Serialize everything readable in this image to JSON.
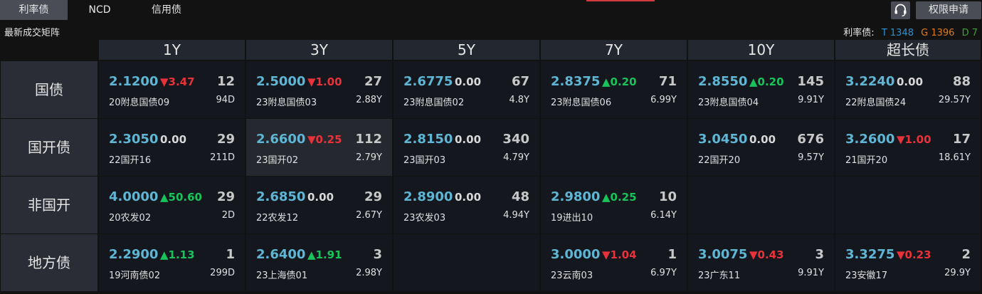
{
  "tabs": [
    {
      "label": "利率债",
      "active": true
    },
    {
      "label": "NCD",
      "active": false
    },
    {
      "label": "信用债",
      "active": false
    }
  ],
  "header_icon": "headset-icon",
  "permission_button": "权限申请",
  "subtitle": "最新成交矩阵",
  "legend": {
    "label": "利率债:",
    "items": [
      {
        "text": "T 1348",
        "color": "#2a93d5"
      },
      {
        "text": "G 1396",
        "color": "#e07c1e"
      },
      {
        "text": "D 7",
        "color": "#3aa33a"
      }
    ]
  },
  "colors": {
    "up": "#19c35b",
    "down": "#e8323a",
    "rate": "#5fb6d4"
  },
  "columns": [
    "1Y",
    "3Y",
    "5Y",
    "7Y",
    "10Y",
    "超长债"
  ],
  "rows": [
    {
      "label": "国债",
      "cells": [
        {
          "rate": "2.1200",
          "dir": "down",
          "change": "3.47",
          "count": "12",
          "name": "20附息国债09",
          "term": "94D"
        },
        {
          "rate": "2.5000",
          "dir": "down",
          "change": "1.00",
          "count": "27",
          "name": "23附息国债03",
          "term": "2.88Y"
        },
        {
          "rate": "2.6775",
          "dir": "flat",
          "change": "0.00",
          "count": "67",
          "name": "23附息国债02",
          "term": "4.8Y"
        },
        {
          "rate": "2.8375",
          "dir": "up",
          "change": "0.20",
          "count": "71",
          "name": "23附息国债06",
          "term": "6.99Y"
        },
        {
          "rate": "2.8550",
          "dir": "up",
          "change": "0.20",
          "count": "145",
          "name": "23附息国债04",
          "term": "9.91Y"
        },
        {
          "rate": "3.2240",
          "dir": "flat",
          "change": "0.00",
          "count": "88",
          "name": "22附息国债24",
          "term": "29.57Y"
        }
      ]
    },
    {
      "label": "国开债",
      "cells": [
        {
          "rate": "2.3050",
          "dir": "flat",
          "change": "0.00",
          "count": "29",
          "name": "22国开16",
          "term": "211D"
        },
        {
          "rate": "2.6600",
          "dir": "down",
          "change": "0.25",
          "count": "112",
          "name": "23国开02",
          "term": "2.79Y",
          "highlight": true
        },
        {
          "rate": "2.8150",
          "dir": "flat",
          "change": "0.00",
          "count": "340",
          "name": "23国开03",
          "term": "4.79Y"
        },
        null,
        {
          "rate": "3.0450",
          "dir": "flat",
          "change": "0.00",
          "count": "676",
          "name": "22国开20",
          "term": "9.57Y"
        },
        {
          "rate": "3.2600",
          "dir": "down",
          "change": "1.00",
          "count": "17",
          "name": "21国开20",
          "term": "18.61Y"
        }
      ]
    },
    {
      "label": "非国开",
      "cells": [
        {
          "rate": "4.0000",
          "dir": "up",
          "change": "50.60",
          "count": "29",
          "name": "20农发02",
          "term": "2D"
        },
        {
          "rate": "2.6850",
          "dir": "flat",
          "change": "0.00",
          "count": "29",
          "name": "22农发12",
          "term": "2.67Y"
        },
        {
          "rate": "2.8900",
          "dir": "flat",
          "change": "0.00",
          "count": "48",
          "name": "23农发03",
          "term": "4.94Y"
        },
        {
          "rate": "2.9800",
          "dir": "up",
          "change": "0.25",
          "count": "10",
          "name": "19进出10",
          "term": "6.14Y"
        },
        null,
        null
      ]
    },
    {
      "label": "地方债",
      "cells": [
        {
          "rate": "2.2900",
          "dir": "up",
          "change": "1.13",
          "count": "1",
          "name": "19河南债02",
          "term": "299D"
        },
        {
          "rate": "2.6400",
          "dir": "up",
          "change": "1.91",
          "count": "3",
          "name": "23上海债01",
          "term": "2.98Y"
        },
        null,
        {
          "rate": "3.0000",
          "dir": "down",
          "change": "1.04",
          "count": "1",
          "name": "23云南03",
          "term": "6.97Y"
        },
        {
          "rate": "3.0075",
          "dir": "down",
          "change": "0.43",
          "count": "3",
          "name": "23广东11",
          "term": "9.91Y"
        },
        {
          "rate": "3.3275",
          "dir": "down",
          "change": "0.23",
          "count": "2",
          "name": "23安徽17",
          "term": "29.9Y"
        }
      ]
    }
  ]
}
